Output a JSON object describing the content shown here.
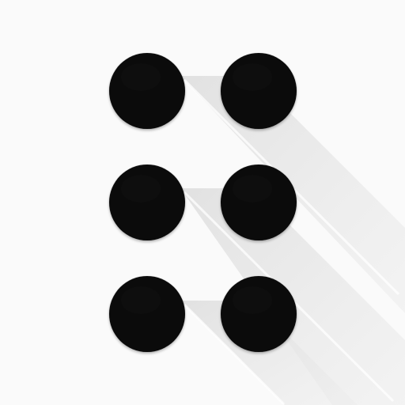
{
  "app": {
    "icon": "six-dot-grid-icon"
  },
  "colors": {
    "background": "#fafafa",
    "dot": "#0b0b0b",
    "long_shadow": "#e9e9e9"
  },
  "grid": {
    "rows": 3,
    "columns": 2,
    "dot_count": 6
  }
}
